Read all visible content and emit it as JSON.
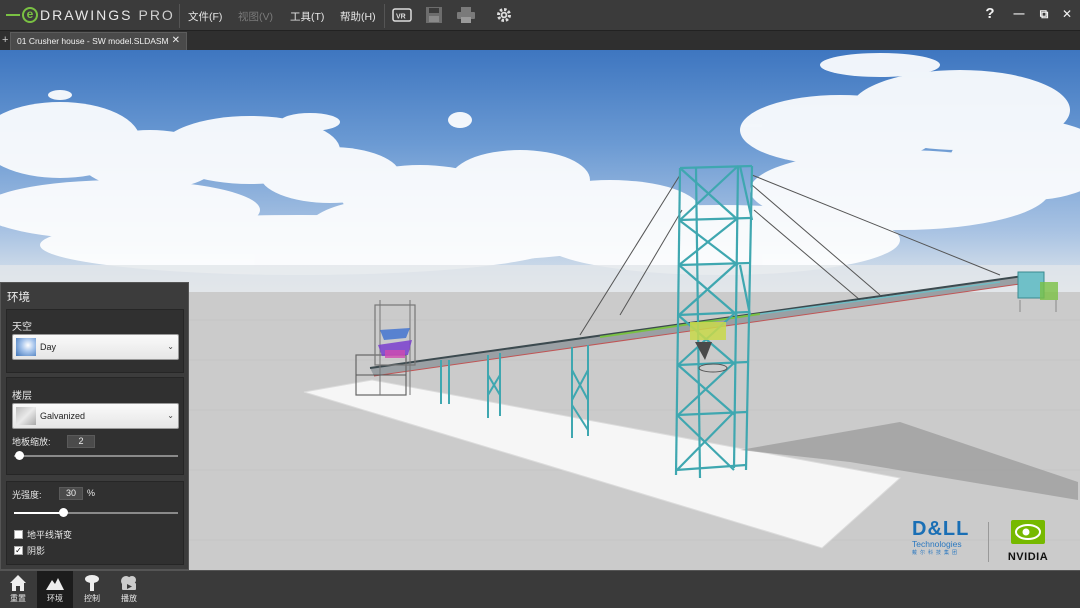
{
  "app": {
    "logo_name": "DRAWINGS",
    "logo_suffix": "PRO"
  },
  "menu": {
    "file": "文件(F)",
    "view": "视图(V)",
    "tools": "工具(T)",
    "help": "帮助(H)"
  },
  "toolbar_icons": [
    "vr-icon",
    "save-icon",
    "print-icon",
    "settings-gear-icon"
  ],
  "window": {
    "help": "?",
    "minimize": "—",
    "restore": "⧉",
    "close": "✕"
  },
  "tabs": {
    "add": "+",
    "active": {
      "label": "01 Crusher house - SW model.SLDASM",
      "close": "✕"
    }
  },
  "environment_panel": {
    "title": "环境",
    "sky": {
      "label": "天空",
      "value": "Day"
    },
    "floor": {
      "label": "楼层",
      "value": "Galvanized",
      "scale_label": "地板缩放:",
      "scale_value": "2",
      "scale_slider": 0.02
    },
    "light": {
      "label": "光强度:",
      "value": "30",
      "unit": "%",
      "slider": 0.3
    },
    "horizon": {
      "label": "地平线渐变",
      "checked": false
    },
    "shadow": {
      "label": "阴影",
      "checked": true
    }
  },
  "bottom_bar": {
    "items": [
      {
        "id": "reset",
        "label": "重置",
        "icon": "home-icon"
      },
      {
        "id": "environment",
        "label": "环境",
        "icon": "mountain-icon",
        "active": true
      },
      {
        "id": "control",
        "label": "控制",
        "icon": "joystick-icon"
      },
      {
        "id": "playback",
        "label": "播放",
        "icon": "camera-play-icon"
      }
    ]
  },
  "brands": {
    "dell_word": "D&LL",
    "dell_sub": "Technologies",
    "dell_cn": "戴尔科技集团",
    "nvidia_word": "NVIDIA"
  },
  "colors": {
    "accent_green": "#7ac143",
    "structure_teal": "#3fa7b0",
    "dell_blue": "#1a6fb5",
    "nvidia_green": "#76b900"
  }
}
